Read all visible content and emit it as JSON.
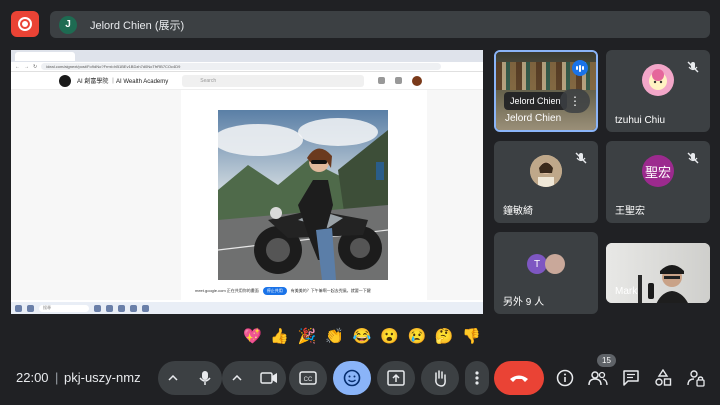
{
  "presenter": {
    "avatar_initial": "J",
    "label": "Jelord Chien (展示)"
  },
  "shared_screen": {
    "browser_url": "ideal.com/aignext/post/Fo9dNo?Frmt=hB1BEv1BDzh7d0NoTfrRB7COc4D9",
    "site_name": "AI 創富學院 ｜AI Wealth Academy",
    "search_placeholder": "Search",
    "caption_link": "meet.google.com 正在共用你的畫面",
    "caption_button": "停止共用",
    "caption_text": "有美美的？下午嘛啊一起去兜風，就要一下鍵",
    "taskbar_search": "搜尋"
  },
  "participants": [
    {
      "name": "Jelord Chien",
      "tooltip": "Jelord Chien",
      "speaking": true
    },
    {
      "name": "tzuhui Chiu",
      "muted": true,
      "avatar_color": "#e57cb4"
    },
    {
      "name": "鐘敏綺",
      "muted": true
    },
    {
      "name": "王聖宏",
      "muted": true,
      "avatar_text": "聖宏",
      "avatar_color": "#9c2a8e"
    },
    {
      "name": "另外 9 人",
      "avatar_initial": "T",
      "avatar_color": "#7e57c2"
    },
    {
      "name": "Mark"
    }
  ],
  "reactions": [
    "💖",
    "👍",
    "🎉",
    "👏",
    "😂",
    "😮",
    "😢",
    "🤔",
    "👎"
  ],
  "meeting": {
    "time": "22:00",
    "separator": "|",
    "code": "pkj-uszy-nmz",
    "participant_count": "15"
  },
  "colors": {
    "background": "#202124",
    "surface": "#3c4043",
    "accent": "#8ab4f8",
    "danger": "#ea4335"
  }
}
